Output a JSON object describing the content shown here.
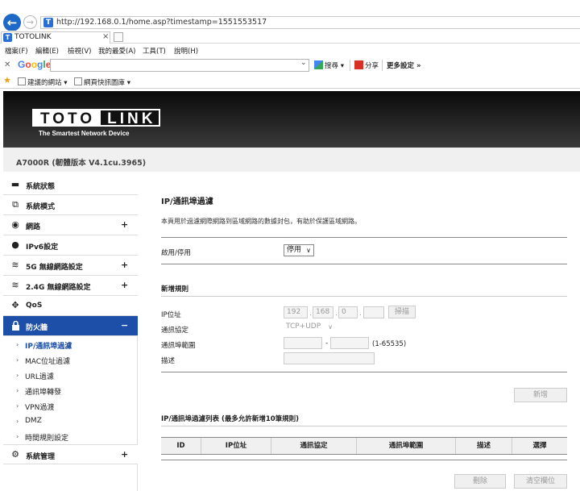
{
  "browser": {
    "url": "http://192.168.0.1/home.asp?timestamp=1551553517",
    "tab_title": "TOTOLINK",
    "tab_favicon": "T",
    "menu": [
      "檔案(F)",
      "編輯(E)",
      "檢視(V)",
      "我的最愛(A)",
      "工具(T)",
      "說明(H)"
    ],
    "google_logo": "Google",
    "google_tools": {
      "search": "搜尋 ▾",
      "share": "分享",
      "more": "更多設定 »"
    },
    "favorites": [
      "建議的網站 ▾",
      "網頁快訊圖庫 ▾"
    ]
  },
  "header": {
    "logo_left": "TOTO",
    "logo_right": "LINK",
    "tagline": "The Smartest Network Device",
    "model": "A7000R (韌體版本 V4.1cu.3965)"
  },
  "sidebar": {
    "items": [
      {
        "label": "系統狀態",
        "icon": "monitor-icon",
        "glyph": "▬",
        "expandable": false
      },
      {
        "label": "系統模式",
        "icon": "mode-icon",
        "glyph": "⧉",
        "expandable": false
      },
      {
        "label": "網路",
        "icon": "globe-icon",
        "glyph": "◉",
        "expandable": true
      },
      {
        "label": "IPv6設定",
        "icon": "ipv6-icon",
        "glyph": "●",
        "expandable": false
      },
      {
        "label": "5G 無線網路設定",
        "icon": "wifi-icon",
        "glyph": "≋",
        "expandable": true
      },
      {
        "label": "2.4G 無線網路設定",
        "icon": "wifi-icon",
        "glyph": "≋",
        "expandable": true
      },
      {
        "label": "QoS",
        "icon": "qos-icon",
        "glyph": "✥",
        "expandable": false
      },
      {
        "label": "防火牆",
        "icon": "lock-icon",
        "glyph": "🔒",
        "expandable": true
      }
    ],
    "collapse_symbol": "−",
    "expand_symbol": "+",
    "firewall_sub": [
      "IP/通訊埠過濾",
      "MAC位址過濾",
      "URL過濾",
      "通訊埠轉發",
      "VPN過渡",
      "DMZ",
      "時間規則設定"
    ],
    "system_mgmt": {
      "label": "系統管理",
      "icon": "gear-icon",
      "glyph": "⚙"
    }
  },
  "content": {
    "title": "IP/通訊埠過濾",
    "description": "本頁用於過濾網際網路到區域網路的數據封包，有助於保護區域網路。",
    "enable_label": "啟用/停用",
    "enable_value": "停用",
    "new_rule_title": "新增規則",
    "ip_label": "IP位址",
    "ip_octets": [
      "192",
      "168",
      "0",
      ""
    ],
    "scan_button": "掃描",
    "protocol_label": "通訊協定",
    "protocol_value": "TCP+UDP",
    "port_range_label": "通訊埠範圍",
    "port_range_sep": "-",
    "port_range_hint": "(1-65535)",
    "desc_label": "描述",
    "add_button": "新增",
    "list_title": "IP/通訊埠過濾列表 (最多允許新增10筆規則)",
    "table_headers": [
      "ID",
      "IP位址",
      "通訊協定",
      "通訊埠範圍",
      "描述",
      "選擇"
    ],
    "delete_button": "刪除",
    "clear_button": "清空欄位"
  }
}
